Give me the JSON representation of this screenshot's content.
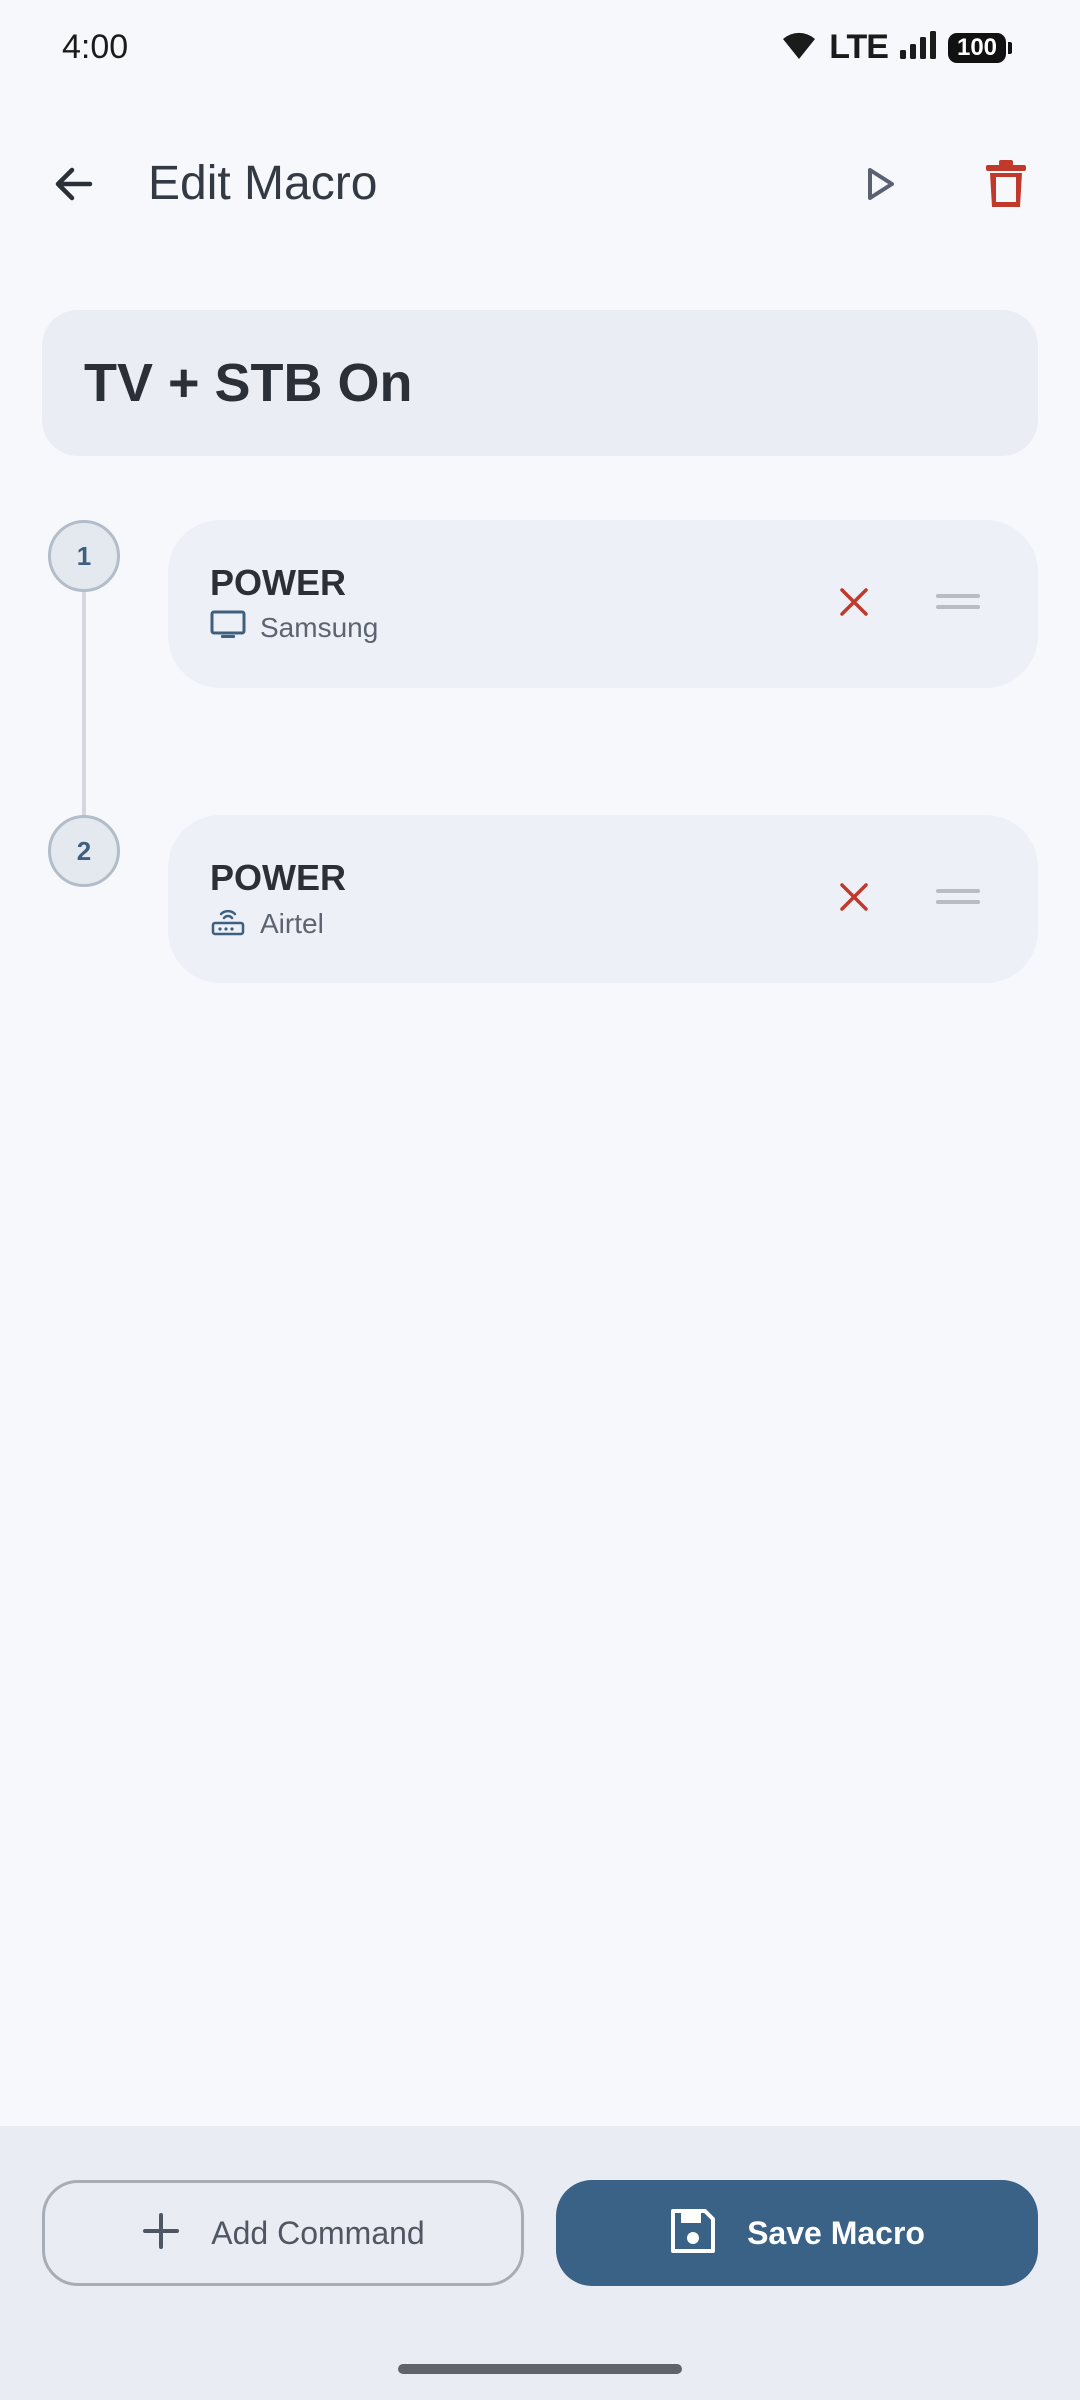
{
  "status_bar": {
    "time": "4:00",
    "network": "LTE",
    "battery": "100",
    "icons": [
      "wifi-icon",
      "signal-icon",
      "battery-icon"
    ]
  },
  "app_bar": {
    "title": "Edit Macro",
    "back_icon": "arrow-back-icon",
    "play_icon": "play-icon",
    "delete_icon": "trash-icon"
  },
  "macro": {
    "name": "TV + STB On"
  },
  "steps": [
    {
      "number": "1",
      "command": "POWER",
      "device": "Samsung",
      "device_icon": "tv-icon"
    },
    {
      "number": "2",
      "command": "POWER",
      "device": "Airtel",
      "device_icon": "router-icon"
    }
  ],
  "bottom_bar": {
    "add_command_label": "Add Command",
    "save_macro_label": "Save Macro"
  },
  "colors": {
    "background": "#f6f8fc",
    "accent": "#3a6186",
    "danger": "#c0392b",
    "card": "#edf1f7"
  }
}
